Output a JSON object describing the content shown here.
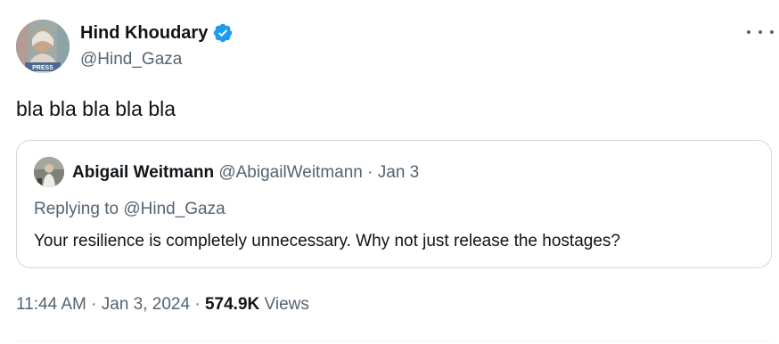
{
  "author": {
    "display_name": "Hind Khoudary",
    "handle": "@Hind_Gaza",
    "verified": true,
    "avatar_icon": "profile-photo-icon",
    "avatar_badge_text": "PRESS"
  },
  "tweet": {
    "text": "bla bla bla bla bla",
    "time": "11:44 AM",
    "date": "Jan 3, 2024",
    "views_count": "574.9K",
    "views_label": "Views"
  },
  "quoted": {
    "display_name": "Abigail Weitmann",
    "handle": "@AbigailWeitmann",
    "date": "Jan 3",
    "replying_to": "Replying to @Hind_Gaza",
    "text": "Your resilience is completely unnecessary. Why not just release the hostages?"
  },
  "colors": {
    "verified_blue": "#1d9bf0",
    "secondary_text": "#536471",
    "primary_text": "#0f1419",
    "border": "#cfd9de"
  }
}
